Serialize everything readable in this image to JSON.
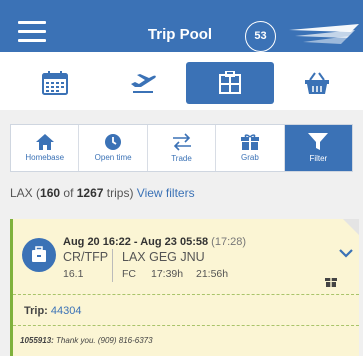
{
  "header": {
    "title": "Trip Pool",
    "badge": "53"
  },
  "tabs": [
    {
      "name": "calendar",
      "icon": "calendar-icon"
    },
    {
      "name": "flights",
      "icon": "airplane-icon"
    },
    {
      "name": "pool",
      "icon": "trip-pool-icon",
      "active": true
    },
    {
      "name": "basket",
      "icon": "basket-icon"
    }
  ],
  "toolbar": {
    "homebase": "Homebase",
    "open_time": "Open time",
    "trade": "Trade",
    "grab": "Grab",
    "filter": "Filter"
  },
  "summary": {
    "base": "LAX",
    "open_paren": " (",
    "shown": "160",
    "of_text": " of ",
    "total": "1267",
    "trips_text": " trips) ",
    "link": "View filters"
  },
  "trip_card": {
    "dates": "Aug 20 16:22 - Aug 23 05:58",
    "duration": "(17:28)",
    "code": "CR/TFP",
    "route": "LAX  GEG  JNU",
    "pay": "16.1",
    "position": "FC",
    "block": "17:39h",
    "credit": "21:56h",
    "trip_label": "Trip:",
    "trip_number": "44304",
    "note_id": "1055913:",
    "note_text": "Thank you. (909) 816-6373"
  },
  "colors": {
    "primary": "#3b72b6",
    "card_bg": "#fbf5d4",
    "card_accent": "#7fb13c"
  }
}
